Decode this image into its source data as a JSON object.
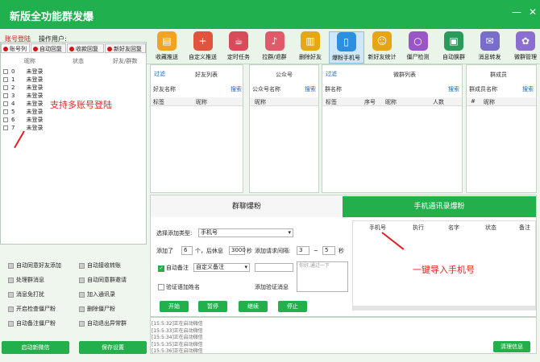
{
  "window": {
    "title": "新版全功能群发爆"
  },
  "header": {
    "login_link": "账号登陆",
    "operator_label": "操作用户:"
  },
  "toolbar": [
    {
      "label": "收藏推送",
      "icon": "folder-icon",
      "color": "#f2a321"
    },
    {
      "label": "自定义推送",
      "icon": "plus-icon",
      "color": "#e2533d"
    },
    {
      "label": "定时任务",
      "icon": "cup-icon",
      "color": "#d74b5a"
    },
    {
      "label": "拉群/退群",
      "icon": "bell-icon",
      "color": "#e05a6a"
    },
    {
      "label": "删除好友",
      "icon": "trash-icon",
      "color": "#e5a712"
    },
    {
      "label": "爆粉手机号",
      "icon": "phone-icon",
      "color": "#2c8fe0"
    },
    {
      "label": "新好友统计",
      "icon": "user-icon",
      "color": "#e7a417"
    },
    {
      "label": "僵尸检测",
      "icon": "magnifier-icon",
      "color": "#9a56c9"
    },
    {
      "label": "自动换群",
      "icon": "chat-icon",
      "color": "#2a9b5b"
    },
    {
      "label": "消息转发",
      "icon": "message-icon",
      "color": "#7a6cc9"
    },
    {
      "label": "微群管理",
      "icon": "gear-icon",
      "color": "#8a6fd0"
    }
  ],
  "left_tabs": [
    "账号列",
    "自动回复",
    "收款回复",
    "新好友回复"
  ],
  "account_columns": [
    "昵称",
    "状态",
    "好友/群数"
  ],
  "accounts": [
    {
      "index": "0",
      "name": "未登录"
    },
    {
      "index": "1",
      "name": "未登录"
    },
    {
      "index": "2",
      "name": "未登录"
    },
    {
      "index": "3",
      "name": "未登录"
    },
    {
      "index": "4",
      "name": "未登录"
    },
    {
      "index": "5",
      "name": "未登录"
    },
    {
      "index": "6",
      "name": "未登录"
    },
    {
      "index": "7",
      "name": "未登录"
    }
  ],
  "annotation_multi": "支持多账号登陆",
  "options": [
    [
      "自动同意好友添加",
      "自动接收转账"
    ],
    [
      "处理群消息",
      "自动同意群邀请"
    ],
    [
      "消息免打扰",
      "加入通讯录"
    ],
    [
      "开启检查僵尸粉",
      "删除僵尸粉"
    ],
    [
      "自动备注僵尸粉",
      "自动退出异常群"
    ]
  ],
  "bottom_buttons": {
    "start_wechat": "启动新微信",
    "save_settings": "保存设置",
    "clear_info": "清理信息"
  },
  "panels": {
    "friends": {
      "filter": "过滤",
      "title": "好友列表",
      "name_label": "好友名称",
      "search": "搜索",
      "cols": [
        "标签",
        "昵称"
      ]
    },
    "official": {
      "title": "公众号",
      "name_label": "公众号名称",
      "search": "搜索",
      "cols": [
        "昵称"
      ]
    },
    "groups": {
      "filter": "过滤",
      "title": "微群列表",
      "name_label": "群名称",
      "search": "搜索",
      "cols": [
        "标签",
        "序号",
        "昵称",
        "人数"
      ]
    },
    "members": {
      "title": "群成员",
      "name_label": "群成员名称",
      "search": "搜索",
      "cols": [
        "#",
        "昵称"
      ]
    }
  },
  "lower_tabs": {
    "group_tab": "群聊爆粉",
    "phone_tab": "手机通讯录爆粉"
  },
  "form": {
    "type_label": "选择添加类型:",
    "type_value": "手机号",
    "add_label": "添加了",
    "add_count": "6",
    "add_unit": "个，后休息",
    "rest_seconds": "3000",
    "rest_unit": "秒",
    "interval_label": "添加请求间隔:",
    "interval_min": "3",
    "interval_sep": "~",
    "interval_max": "5",
    "interval_unit": "秒",
    "remark_label": "自动备注",
    "remark_value": "自定义备注",
    "greeting_placeholder": "你好,通过一下",
    "verify_name_label": "验证语加姓名",
    "verify_msg_label": "添加验证消息"
  },
  "action_buttons": [
    "开始",
    "暂停",
    "继续",
    "停止"
  ],
  "phone_columns": [
    "手机号",
    "执行",
    "名字",
    "状态",
    "备注"
  ],
  "annotation_phone": "一键导入手机号",
  "log_lines": [
    "[15:5:32]正在启动微信",
    "[15:5:33]正在启动微信",
    "[15:5:34]正在启动微信",
    "[15:5:35]正在启动微信",
    "[15:5:36]正在启动微信"
  ]
}
